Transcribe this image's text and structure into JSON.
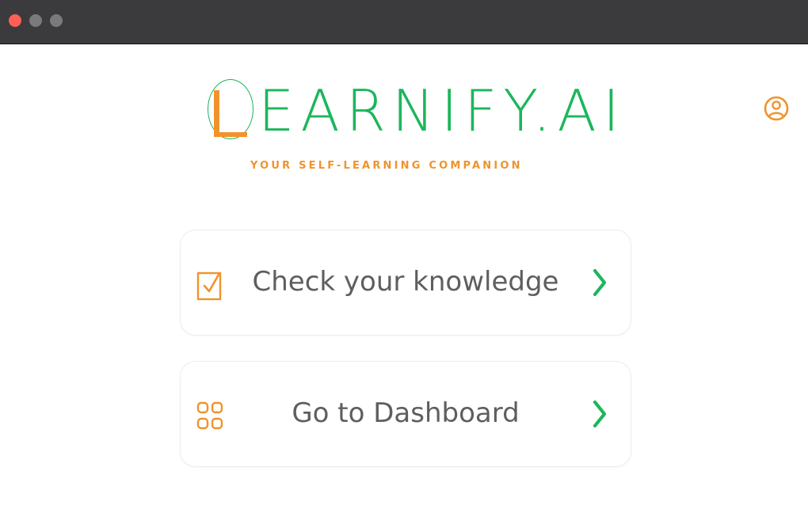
{
  "window": {
    "traffic_lights": [
      "close",
      "minimize",
      "maximize"
    ],
    "titlebar_color": "#3b3a3c"
  },
  "brand": {
    "logo_letter": "L",
    "logo_rest": "EARNIFY.AI",
    "tagline": "YOUR SELF-LEARNING COMPANION",
    "primary_color": "#1cb65c",
    "accent_color": "#f0932b"
  },
  "header": {
    "profile_icon": "user-circle-icon"
  },
  "actions": [
    {
      "label": "Check your knowledge",
      "icon": "checkbox-icon",
      "chevron_icon": "chevron-right-icon"
    },
    {
      "label": "Go to Dashboard",
      "icon": "grid-icon",
      "chevron_icon": "chevron-right-icon"
    }
  ]
}
